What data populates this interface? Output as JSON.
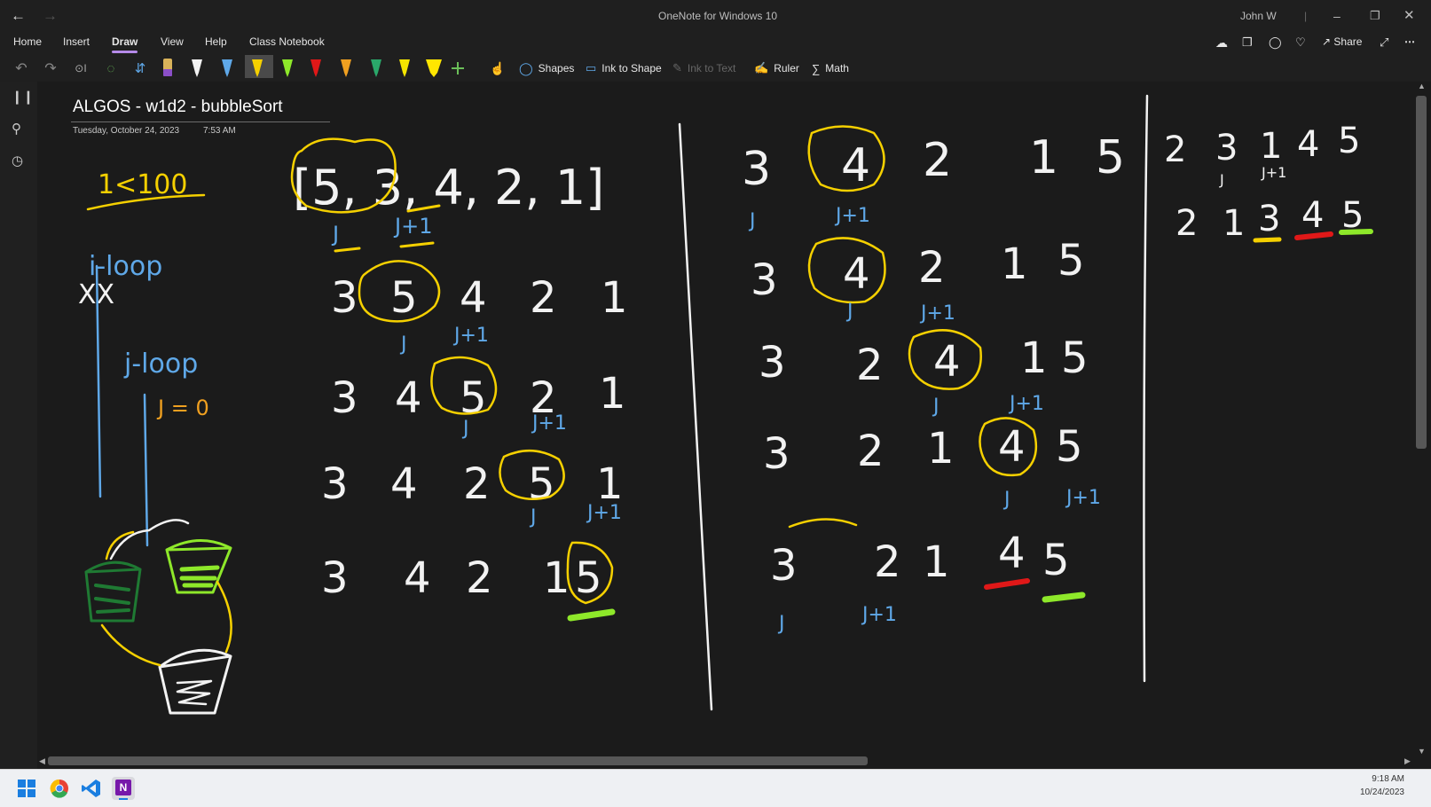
{
  "window": {
    "title": "OneNote for Windows 10",
    "user": "John W"
  },
  "ribbon": {
    "tabs": [
      "Home",
      "Insert",
      "Draw",
      "View",
      "Help",
      "Class Notebook"
    ],
    "active_tab": "Draw",
    "share_label": "Share"
  },
  "draw_toolbar": {
    "shapes_label": "Shapes",
    "ink_to_shape_label": "Ink to Shape",
    "ink_to_text_label": "Ink to Text",
    "ruler_label": "Ruler",
    "math_label": "Math"
  },
  "page": {
    "title": "ALGOS - w1d2 - bubbleSort",
    "date": "Tuesday, October 24, 2023",
    "time": "7:53 AM"
  },
  "ink_notes": {
    "condition": "1<100",
    "i_loop": "i-loop",
    "xx": "XX",
    "j_loop": "j-loop",
    "j_init": "J = 0",
    "array_start": "[5, 3, 4, 2, 1]",
    "row1": [
      "3",
      "5",
      "4",
      "2",
      "1"
    ],
    "row2": [
      "3",
      "4",
      "5",
      "2",
      "1"
    ],
    "row3": [
      "3",
      "4",
      "2",
      "5",
      "1"
    ],
    "row4": [
      "3",
      "4",
      "2",
      "1",
      "5"
    ],
    "mid_row0": [
      "3",
      "4",
      "2",
      "1",
      "5"
    ],
    "mid_row1": [
      "3",
      "4",
      "2",
      "1",
      "5"
    ],
    "mid_row2": [
      "3",
      "2",
      "4",
      "1",
      "5"
    ],
    "mid_row3": [
      "3",
      "2",
      "1",
      "4",
      "5"
    ],
    "mid_row4": [
      "3",
      "2",
      "1",
      "4",
      "5"
    ],
    "right_row0": [
      "2",
      "3",
      "1",
      "4",
      "5"
    ],
    "right_row1": [
      "2",
      "1",
      "3",
      "4",
      "5"
    ],
    "j_label": "J",
    "j1_label": "J+1"
  },
  "taskbar": {
    "time": "9:18 AM",
    "date": "10/24/2023"
  },
  "colors": {
    "ink_white": "#f2f2f2",
    "ink_blue": "#5fa8e8",
    "ink_yellow": "#f5d000",
    "ink_orange": "#f0a020",
    "ink_green": "#8ee82a",
    "ink_dark_green": "#1f7a33",
    "ink_red": "#e01818",
    "accent": "#b58ae8"
  }
}
